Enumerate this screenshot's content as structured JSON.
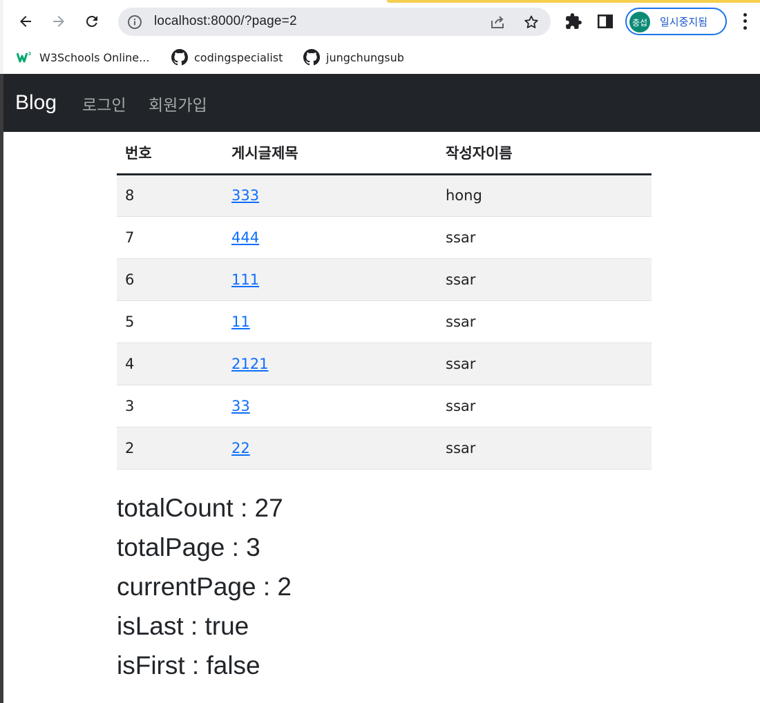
{
  "browser": {
    "url": "localhost:8000/?page=2",
    "profile_label": "일시중지됨",
    "profile_avatar": "충섭",
    "bookmarks": [
      {
        "label": "W3Schools Online...",
        "icon": "w3schools-icon"
      },
      {
        "label": "codingspecialist",
        "icon": "github-icon"
      },
      {
        "label": "jungchungsub",
        "icon": "github-icon"
      }
    ],
    "accent_color": "#1a73e8"
  },
  "navbar": {
    "brand": "Blog",
    "links": [
      {
        "label": "로그인"
      },
      {
        "label": "회원가입"
      }
    ],
    "background": "#212529"
  },
  "table": {
    "headers": [
      "번호",
      "게시글제목",
      "작성자이름"
    ],
    "rows": [
      {
        "id": "8",
        "title": "333",
        "author": "hong"
      },
      {
        "id": "7",
        "title": "444",
        "author": "ssar"
      },
      {
        "id": "6",
        "title": "111",
        "author": "ssar"
      },
      {
        "id": "5",
        "title": "11",
        "author": "ssar"
      },
      {
        "id": "4",
        "title": "2121",
        "author": "ssar"
      },
      {
        "id": "3",
        "title": "33",
        "author": "ssar"
      },
      {
        "id": "2",
        "title": "22",
        "author": "ssar"
      }
    ]
  },
  "stats": [
    "totalCount : 27",
    "totalPage : 3",
    "currentPage : 2",
    "isLast : true",
    "isFirst : false"
  ]
}
